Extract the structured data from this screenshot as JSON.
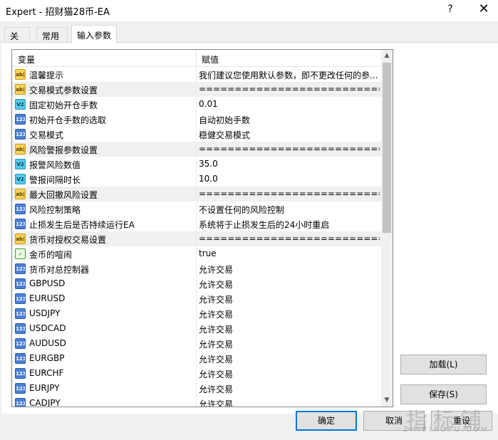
{
  "window": {
    "title": "Expert - 招财猫28币-EA",
    "help": "?",
    "close": "✕"
  },
  "tabs": [
    {
      "label": "关于",
      "active": false
    },
    {
      "label": "常用",
      "active": false
    },
    {
      "label": "输入参数",
      "active": true
    }
  ],
  "grid": {
    "header": {
      "name": "变量",
      "value": "赋值"
    },
    "rows": [
      {
        "icon": "string-icon",
        "name": "温馨提示",
        "value": "我们建议您使用默认参数，即不更改任何的参...",
        "group": false
      },
      {
        "icon": "string-icon",
        "name": "交易模式参数设置",
        "value": "==========================================",
        "group": true
      },
      {
        "icon": "double-icon",
        "name": "固定初始开仓手数",
        "value": "0.01",
        "group": false
      },
      {
        "icon": "integer-icon",
        "name": "初始开仓手数的选取",
        "value": "自动初始手数",
        "group": false
      },
      {
        "icon": "integer-icon",
        "name": "交易模式",
        "value": "稳健交易模式",
        "group": false
      },
      {
        "icon": "string-icon",
        "name": "风险警报参数设置",
        "value": "==========================================",
        "group": true
      },
      {
        "icon": "double-icon",
        "name": "报警风险数值",
        "value": "35.0",
        "group": false
      },
      {
        "icon": "double-icon",
        "name": "警报间隔时长",
        "value": "10.0",
        "group": false
      },
      {
        "icon": "string-icon",
        "name": "最大回撤风险设置",
        "value": "==========================================",
        "group": true
      },
      {
        "icon": "integer-icon",
        "name": "风险控制策略",
        "value": "不设置任何的风险控制",
        "group": false
      },
      {
        "icon": "integer-icon",
        "name": "止损发生后是否持续运行EA",
        "value": "系统将于止损发生后的24小时重启",
        "group": false
      },
      {
        "icon": "string-icon",
        "name": "货币对授权交易设置",
        "value": "==========================================",
        "group": true
      },
      {
        "icon": "bool-icon",
        "name": "金币的喧闹",
        "value": "true",
        "group": false
      },
      {
        "icon": "integer-icon",
        "name": "货币对总控制器",
        "value": "允许交易",
        "group": false
      },
      {
        "icon": "integer-icon",
        "name": "GBPUSD",
        "value": "允许交易",
        "group": false
      },
      {
        "icon": "integer-icon",
        "name": "EURUSD",
        "value": "允许交易",
        "group": false
      },
      {
        "icon": "integer-icon",
        "name": "USDJPY",
        "value": "允许交易",
        "group": false
      },
      {
        "icon": "integer-icon",
        "name": "USDCAD",
        "value": "允许交易",
        "group": false
      },
      {
        "icon": "integer-icon",
        "name": "AUDUSD",
        "value": "允许交易",
        "group": false
      },
      {
        "icon": "integer-icon",
        "name": "EURGBP",
        "value": "允许交易",
        "group": false
      },
      {
        "icon": "integer-icon",
        "name": "EURCHF",
        "value": "允许交易",
        "group": false
      },
      {
        "icon": "integer-icon",
        "name": "EURJPY",
        "value": "允许交易",
        "group": false
      },
      {
        "icon": "integer-icon",
        "name": "CADJPY",
        "value": "允许交易",
        "group": false
      }
    ]
  },
  "icon_glyphs": {
    "string-icon": "ab|",
    "double-icon": "V2",
    "integer-icon": "123",
    "bool-icon": "✓"
  },
  "buttons": {
    "load": "加载(L)",
    "save": "保存(S)",
    "ok": "确定",
    "cancel": "取消",
    "reset": "重设"
  },
  "watermark": {
    "cn": "指标铺",
    "en": "ZHIBIAOPU.COM"
  }
}
